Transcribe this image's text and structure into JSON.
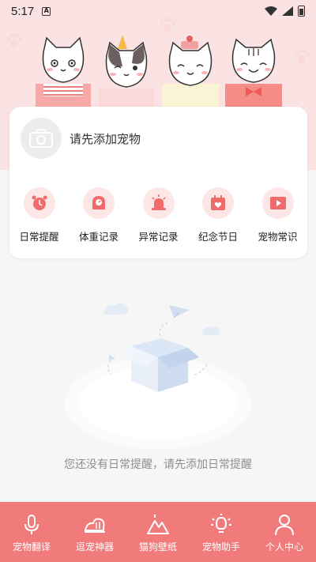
{
  "status_bar": {
    "time": "5:17",
    "notification_icon": "A"
  },
  "pet": {
    "add_prompt": "请先添加宠物"
  },
  "features": [
    {
      "label": "日常提醒",
      "icon": "alarm-clock-icon"
    },
    {
      "label": "体重记录",
      "icon": "scale-icon"
    },
    {
      "label": "异常记录",
      "icon": "siren-icon"
    },
    {
      "label": "纪念节日",
      "icon": "calendar-heart-icon"
    },
    {
      "label": "宠物常识",
      "icon": "video-play-icon"
    }
  ],
  "empty_state": {
    "message": "您还没有日常提醒，请先添加日常提醒"
  },
  "bottom_nav": [
    {
      "label": "宠物翻译",
      "icon": "microphone-icon"
    },
    {
      "label": "逗宠神器",
      "icon": "paw-toy-icon"
    },
    {
      "label": "猫狗壁纸",
      "icon": "mountain-image-icon"
    },
    {
      "label": "宠物助手",
      "icon": "lightbulb-icon"
    },
    {
      "label": "个人中心",
      "icon": "person-icon"
    }
  ],
  "colors": {
    "accent": "#f17b7b",
    "header_pink": "#fbe3e4",
    "icon_bg": "#fde6e6",
    "icon_fg": "#f26b6b"
  }
}
